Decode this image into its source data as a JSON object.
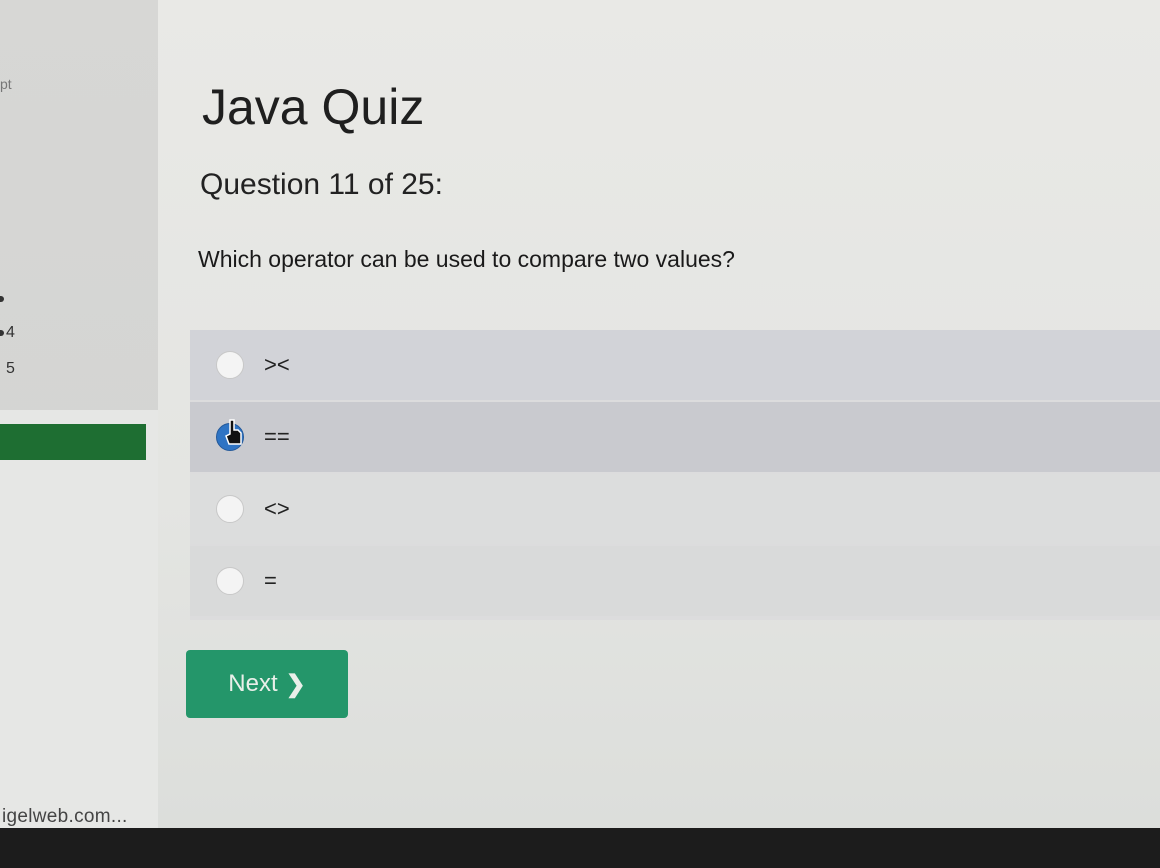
{
  "sidebar": {
    "partial_top": "pt",
    "partial_4": "4",
    "partial_5": "5",
    "footer_link": "igelweb.com..."
  },
  "quiz": {
    "title": "Java Quiz",
    "progress": "Question 11 of 25:",
    "question": "Which operator can be used to compare two values?",
    "options": [
      {
        "label": "><",
        "selected": false
      },
      {
        "label": "==",
        "selected": true
      },
      {
        "label": "<>",
        "selected": false
      },
      {
        "label": "=",
        "selected": false
      }
    ],
    "next_label": "Next",
    "next_icon": "chevron-right-icon"
  },
  "colors": {
    "active_nav": "#1e6e32",
    "next_button": "#24966a",
    "selected_radio": "#2f74c4"
  }
}
